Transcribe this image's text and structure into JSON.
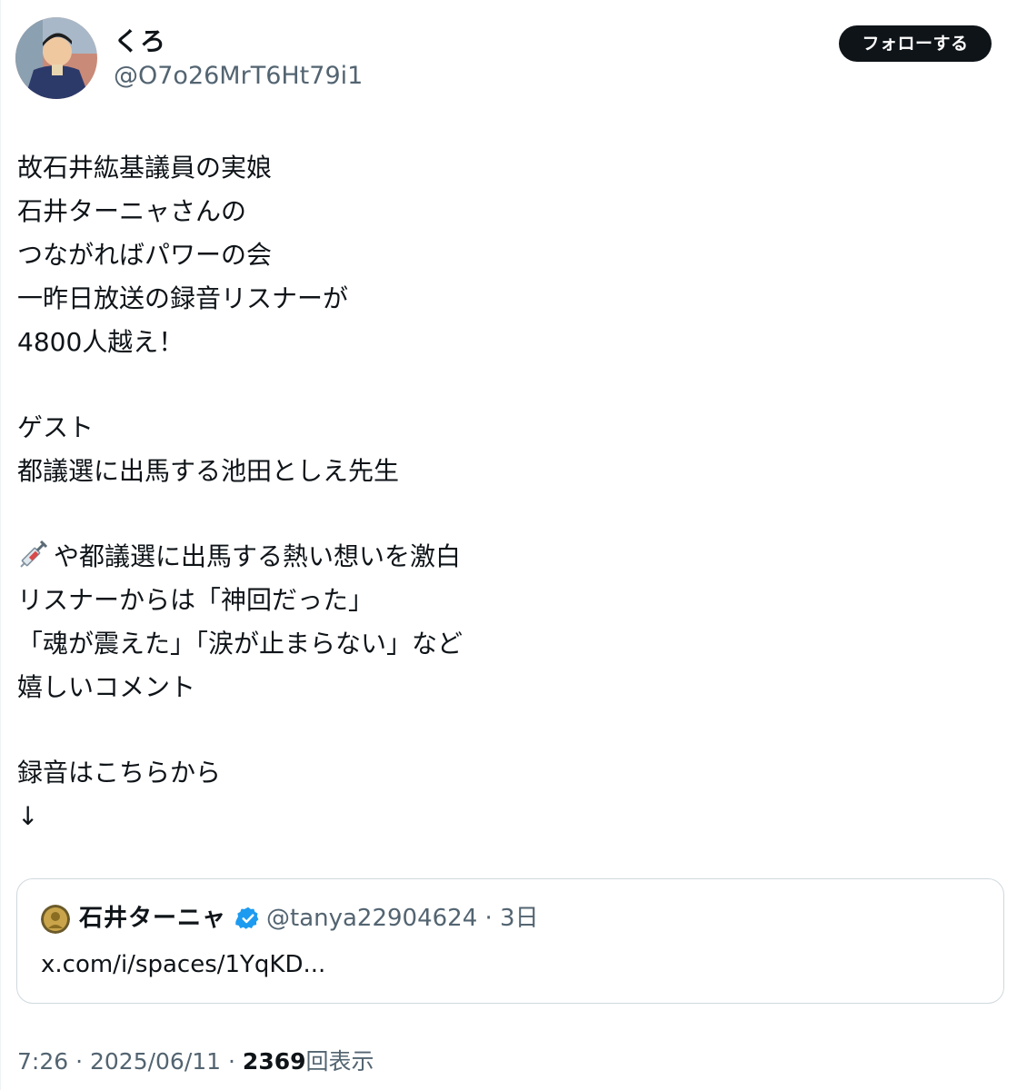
{
  "author": {
    "display_name": "くろ",
    "handle": "@O7o26MrT6Ht79i1"
  },
  "follow_button": "フォローする",
  "tweet_lines": {
    "l1": "故石井紘基議員の実娘",
    "l2": "石井ターニャさんの",
    "l3": "つながればパワーの会",
    "l4": "一昨日放送の録音リスナーが",
    "l5": "4800人越え！",
    "l6": "ゲスト",
    "l7": "都議選に出馬する池田としえ先生",
    "l8": "や都議選に出馬する熱い想いを激白",
    "l9": "リスナーからは「神回だった」",
    "l10": "「魂が震えた」「涙が止まらない」など",
    "l11": "嬉しいコメント",
    "l12": "録音はこちらから",
    "l13": "↓"
  },
  "emoji": {
    "syringe": "syringe-icon"
  },
  "quote": {
    "name": "石井ターニャ",
    "handle_time": "@tanya22904624 · 3日",
    "link": "x.com/i/spaces/1YqKD..."
  },
  "meta": {
    "time_date": "7:26 · 2025/06/11 · ",
    "views": "2369",
    "views_label": "回表示"
  },
  "colors": {
    "text": "#0f1419",
    "secondary": "#536471",
    "verified": "#1d9bf0",
    "border": "#cfd9de"
  }
}
